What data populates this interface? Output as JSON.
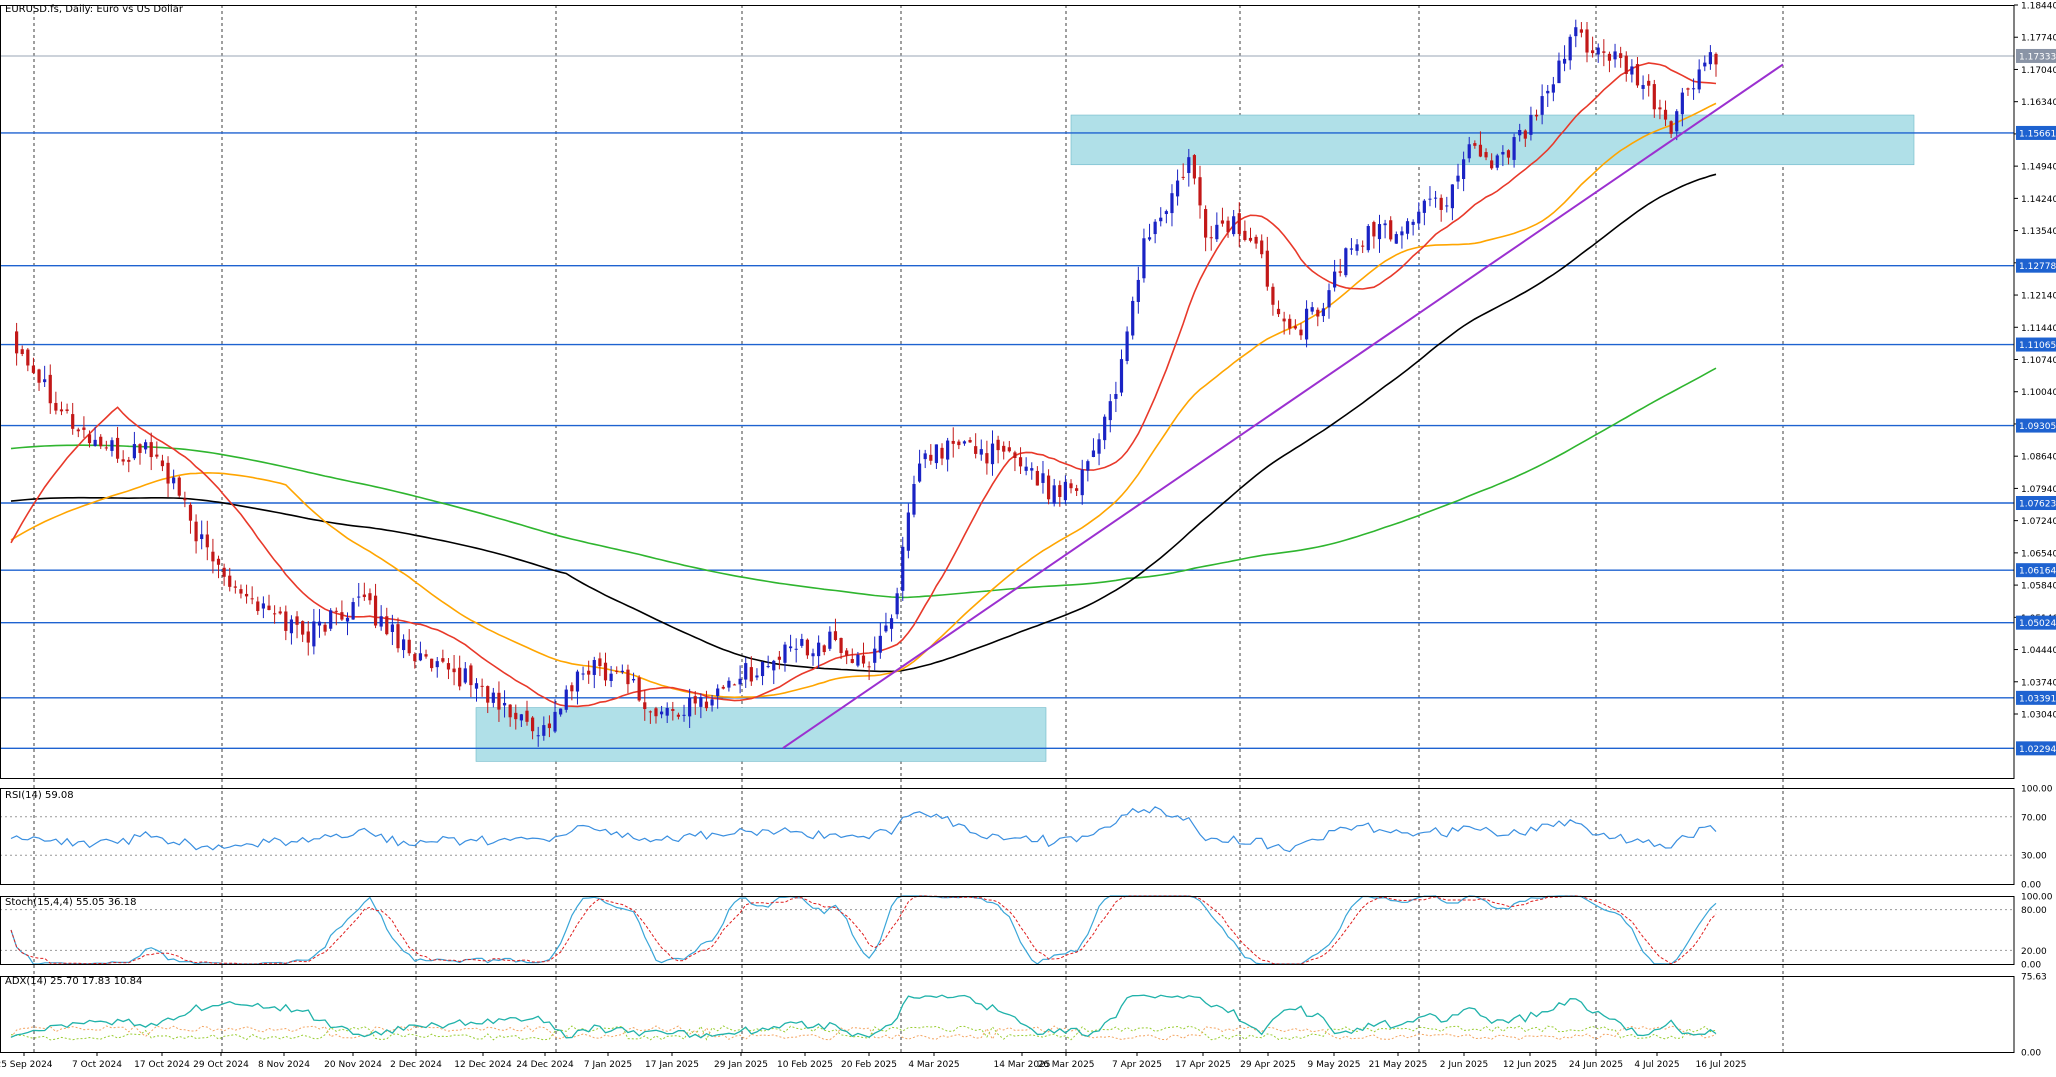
{
  "header": {
    "symbol_line": "EURUSD.fs, Daily:  Euro vs US Dollar"
  },
  "panes": {
    "rsi_label": "RSI(14) 59.08",
    "stoch_label": "Stoch(15,4,4) 55.05 36.18",
    "adx_label": "ADX(14) 25.70 17.83 10.84"
  },
  "chart_data": [
    {
      "type": "candlestick",
      "title": "EURUSD.fs, Daily: Euro vs US Dollar",
      "ylim": [
        1.0165,
        1.1844
      ],
      "grid": "vertical dotted",
      "y_ticks": [
        "1.18440",
        "1.17740",
        "1.17040",
        "1.16340",
        "1.15640",
        "1.14940",
        "1.14240",
        "1.13540",
        "1.12840",
        "1.12140",
        "1.11440",
        "1.10740",
        "1.10040",
        "1.09340",
        "1.08640",
        "1.07940",
        "1.07240",
        "1.06540",
        "1.05840",
        "1.05140",
        "1.04440",
        "1.03740",
        "1.03040"
      ],
      "x_labels": [
        "25 Sep 2024",
        "7 Oct 2024",
        "17 Oct 2024",
        "29 Oct 2024",
        "8 Nov 2024",
        "20 Nov 2024",
        "2 Dec 2024",
        "12 Dec 2024",
        "24 Dec 2024",
        "7 Jan 2025",
        "17 Jan 2025",
        "29 Jan 2025",
        "10 Feb 2025",
        "20 Feb 2025",
        "4 Mar 2025",
        "14 Mar 2025",
        "26 Mar 2025",
        "7 Apr 2025",
        "17 Apr 2025",
        "29 Apr 2025",
        "9 May 2025",
        "21 May 2025",
        "2 Jun 2025",
        "12 Jun 2025",
        "24 Jun 2025",
        "4 Jul 2025",
        "16 Jul 2025"
      ],
      "current_price": "1.17333",
      "horizontal_levels": [
        "1.15661",
        "1.12778",
        "1.11065",
        "1.09305",
        "1.07623",
        "1.06164",
        "1.05024",
        "1.03391",
        "1.02294"
      ],
      "zones": [
        {
          "top": 1.0318,
          "bottom": 1.0201,
          "from": "12 Dec 2024",
          "to": "26 Mar 2025",
          "color": "#b0e0e8"
        },
        {
          "top": 1.1605,
          "bottom": 1.1497,
          "from": "7 Apr 2025",
          "to": "Aug 2025",
          "color": "#b0e0e8"
        }
      ],
      "trendline": {
        "from": [
          "Jan 2025",
          1.023
        ],
        "to": [
          "Aug 2025",
          1.1715
        ],
        "color": "#9b30d0"
      },
      "ma_colors": {
        "ma20": "#e8392a",
        "ma50": "#ffa500",
        "ma100": "#000000",
        "ma200": "#2fb52f"
      },
      "up_color": "#1a23c4",
      "down_color": "#c21818"
    },
    {
      "type": "line",
      "title": "RSI(14) 59.08",
      "ylim": [
        0,
        100
      ],
      "y_ticks": [
        "100.00",
        "70.00",
        "30.00",
        "0.00"
      ],
      "series": [
        {
          "name": "RSI(14)",
          "last": 59.08
        }
      ]
    },
    {
      "type": "line",
      "title": "Stoch(15,4,4) 55.05 36.18",
      "ylim": [
        0,
        100
      ],
      "y_ticks": [
        "100.00",
        "80.00",
        "20.00",
        "0.00"
      ],
      "series": [
        {
          "name": "Main",
          "last": 55.05
        },
        {
          "name": "Signal",
          "last": 36.18
        }
      ]
    },
    {
      "type": "line",
      "title": "ADX(14) 25.70 17.83 10.84",
      "ylim": [
        0,
        75.63
      ],
      "y_ticks": [
        "75.63",
        "0.00"
      ],
      "series": [
        {
          "name": "ADX",
          "last": 25.7
        },
        {
          "name": "+DI",
          "last": 17.83
        },
        {
          "name": "-DI",
          "last": 10.84
        }
      ]
    }
  ]
}
